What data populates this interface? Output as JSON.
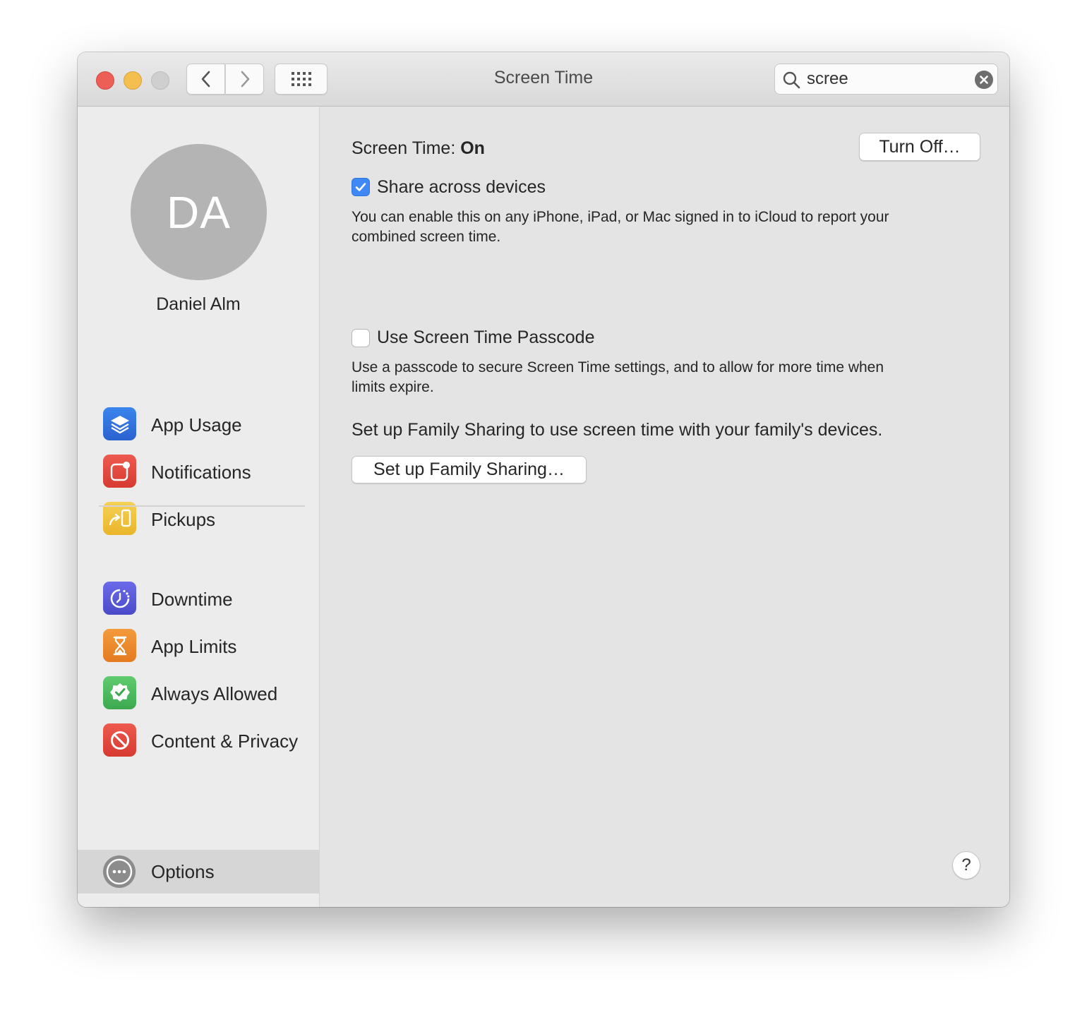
{
  "window": {
    "title": "Screen Time",
    "search": {
      "value": "scree",
      "placeholder": "Search"
    }
  },
  "sidebar": {
    "avatar_initials": "DA",
    "user_name": "Daniel Alm",
    "items": [
      {
        "label": "App Usage",
        "icon": "layers-icon",
        "color": "#2f6fd9"
      },
      {
        "label": "Notifications",
        "icon": "notification-icon",
        "color": "#e2463c"
      },
      {
        "label": "Pickups",
        "icon": "pickup-icon",
        "color": "#f0c33c"
      },
      {
        "label": "Downtime",
        "icon": "downtime-icon",
        "color": "#5b5bd8"
      },
      {
        "label": "App Limits",
        "icon": "hourglass-icon",
        "color": "#ef8a2d"
      },
      {
        "label": "Always Allowed",
        "icon": "checkmark-badge-icon",
        "color": "#4dbb5f"
      },
      {
        "label": "Content & Privacy",
        "icon": "no-entry-icon",
        "color": "#e2463c"
      }
    ],
    "options_label": "Options"
  },
  "main": {
    "status_prefix": "Screen Time:",
    "status_value": "On",
    "turn_off_label": "Turn Off…",
    "share": {
      "label": "Share across devices",
      "checked": true,
      "description_line1": "You can enable this on any iPhone, iPad, or Mac signed in to iCloud to report your",
      "description_line2": "combined screen time."
    },
    "passcode": {
      "label": "Use Screen Time Passcode",
      "checked": false,
      "description_line1": "Use a passcode to secure Screen Time settings, and to allow for more time when",
      "description_line2": "limits expire."
    },
    "family_text": "Set up Family Sharing to use screen time with your family's devices.",
    "family_button_label": "Set up Family Sharing…",
    "help_label": "?"
  }
}
